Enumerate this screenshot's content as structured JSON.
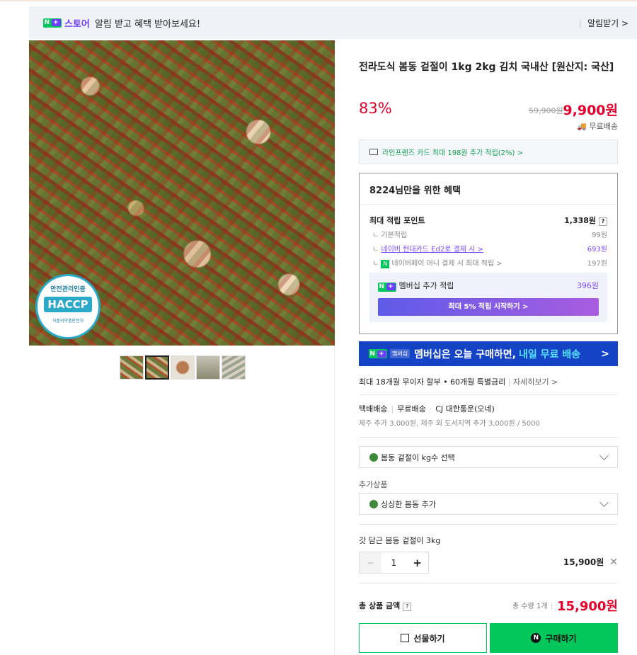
{
  "banner": {
    "logo": "N+",
    "store": "스토어",
    "text": "알림 받고 혜택 받아보세요!",
    "alarm": "알림받기 >"
  },
  "image": {
    "haccp_top": "안전관리인증",
    "haccp_mid": "HACCP",
    "haccp_bottom": "식품의약품안전처"
  },
  "product": {
    "title": "전라도식 봄동 겉절이 1kg 2kg 김치 국내산 [원산지: 국산]",
    "discount": "83%",
    "old_price": "59,900원",
    "price": "9,900원",
    "shipping": "무료배송",
    "card_benefit": "라인프렌즈 카드 최대 198원 추가 적립(2%) >"
  },
  "benefit": {
    "title": "8224님만을 위한 혜택",
    "max_point_label": "최대 적립 포인트",
    "max_point_value": "1,338원",
    "help": "?",
    "basic_label": "기본적립",
    "basic_value": "99원",
    "card_label": "네이버 현대카드 Ed2로 결제 시 >",
    "card_value": "693원",
    "pay_label": "네이버페이 머니 결제 시 최대 적립 >",
    "pay_value": "197원",
    "member_label": "멤버십 추가 적립",
    "member_value": "396원",
    "member_btn": "최대 5% 적립 시작하기 >"
  },
  "membership_banner": {
    "tag": "멤버십",
    "text": "멤버십은 오늘 구매하면,",
    "highlight": "내일 무료 배송",
    "arrow": ">"
  },
  "installment": {
    "text": "최대 18개월 무이자 할부 • 60개월 특별금리",
    "link": "자세히보기 >"
  },
  "delivery": {
    "type": "택배배송",
    "fee": "무료배송",
    "carrier": "CJ 대한통운(오네)",
    "extra": "제주 추가 3,000원, 제주 외 도서지역 추가 3,000원 / 5000"
  },
  "options": {
    "select1": "봄동 겉절이 kg수 선택",
    "add_label": "추가상품",
    "select2": "싱싱한 봄동 추가"
  },
  "selected": {
    "name": "갓 담근 봄동 겉절이 3kg",
    "qty": "1",
    "minus": "−",
    "plus": "+",
    "price": "15,900원",
    "remove": "✕"
  },
  "total": {
    "label": "총 상품 금액",
    "help": "?",
    "qty": "총 수량 1개",
    "price": "15,900원"
  },
  "buttons": {
    "gift": "선물하기",
    "buy": "구매하기",
    "buy_icon": "N"
  }
}
